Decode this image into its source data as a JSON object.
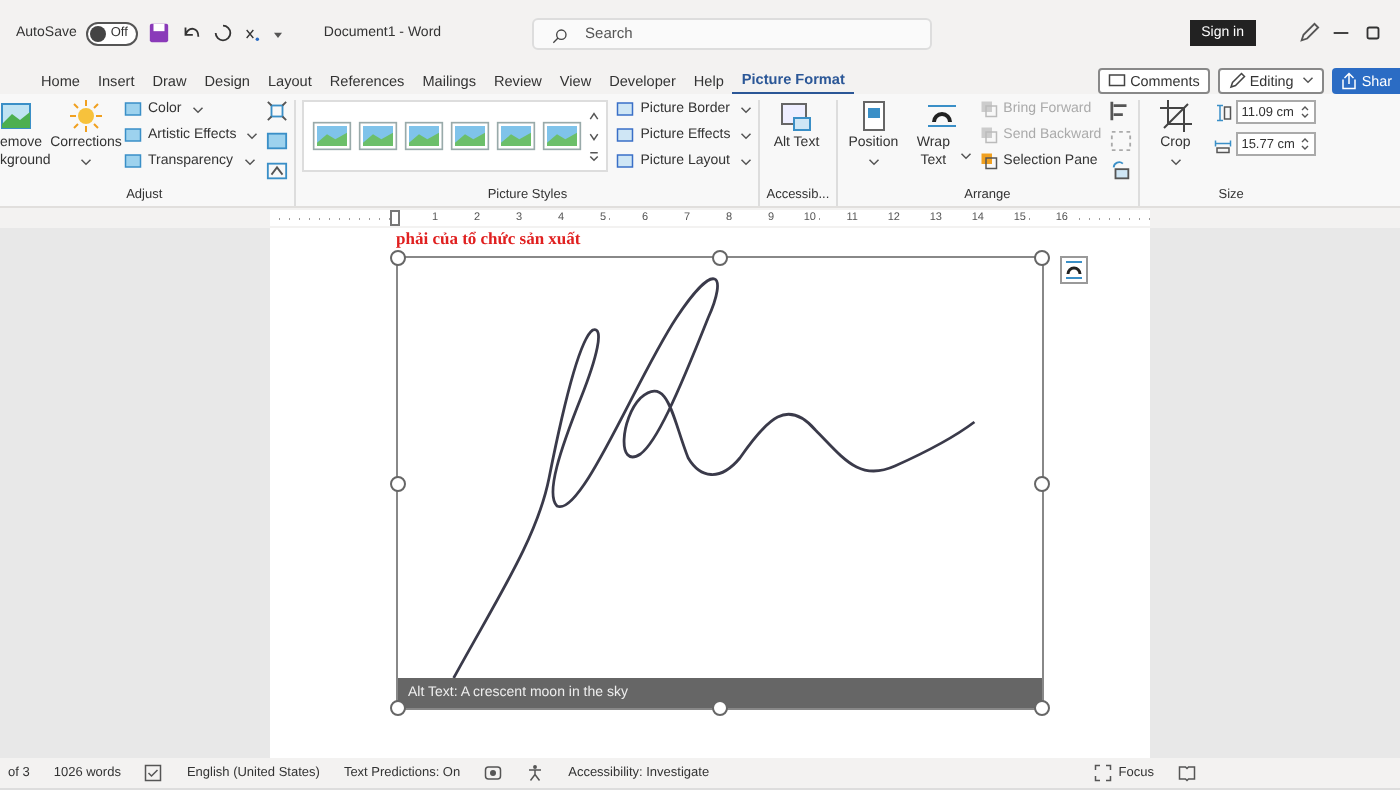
{
  "title_bar": {
    "autosave": "AutoSave",
    "toggle": {
      "text": "Off",
      "on": false
    },
    "document_title": "Document1 - Word",
    "search": {
      "placeholder": "Search"
    },
    "sign_in": "Sign in"
  },
  "tabs": [
    {
      "label": "Home",
      "selected": false
    },
    {
      "label": "Insert",
      "selected": false
    },
    {
      "label": "Draw",
      "selected": false
    },
    {
      "label": "Design",
      "selected": false
    },
    {
      "label": "Layout",
      "selected": false
    },
    {
      "label": "References",
      "selected": false
    },
    {
      "label": "Mailings",
      "selected": false
    },
    {
      "label": "Review",
      "selected": false
    },
    {
      "label": "View",
      "selected": false
    },
    {
      "label": "Developer",
      "selected": false
    },
    {
      "label": "Help",
      "selected": false
    },
    {
      "label": "Picture Format",
      "selected": true
    }
  ],
  "tab_actions": {
    "comments": "Comments",
    "editing": "Editing",
    "share": "Shar"
  },
  "ribbon": {
    "adjust": {
      "label": "Adjust",
      "remove_background": "emove kground",
      "corrections": "Corrections",
      "menu": [
        "Color",
        "Artistic Effects",
        "Transparency"
      ]
    },
    "picture_styles": {
      "label": "Picture Styles",
      "menu": [
        "Picture Border",
        "Picture Effects",
        "Picture Layout"
      ]
    },
    "accessibility": {
      "label": "Accessib...",
      "alt_text": "Alt Text"
    },
    "arrange": {
      "label": "Arrange",
      "position": "Position",
      "wrap_text": "Wrap Text",
      "menu": [
        {
          "label": "Bring Forward",
          "disabled": true
        },
        {
          "label": "Send Backward",
          "disabled": true
        },
        {
          "label": "Selection Pane",
          "disabled": false
        }
      ]
    },
    "size": {
      "label": "Size",
      "crop": "Crop",
      "height": "11.09 cm",
      "width": "15.77 cm"
    }
  },
  "ruler": [
    "1",
    "2",
    "3",
    "4",
    "5",
    "6",
    "7",
    "8",
    "9",
    "10",
    "11",
    "12",
    "13",
    "14",
    "15",
    "16"
  ],
  "document": {
    "text": "phải của tổ chức sản xuất",
    "alt_text": "Alt Text: A crescent moon in the sky"
  },
  "status_bar": {
    "page": "of 3",
    "words": "1026 words",
    "language": "English (United States)",
    "predictions": "Text Predictions: On",
    "accessibility": "Accessibility: Investigate",
    "focus": "Focus"
  }
}
